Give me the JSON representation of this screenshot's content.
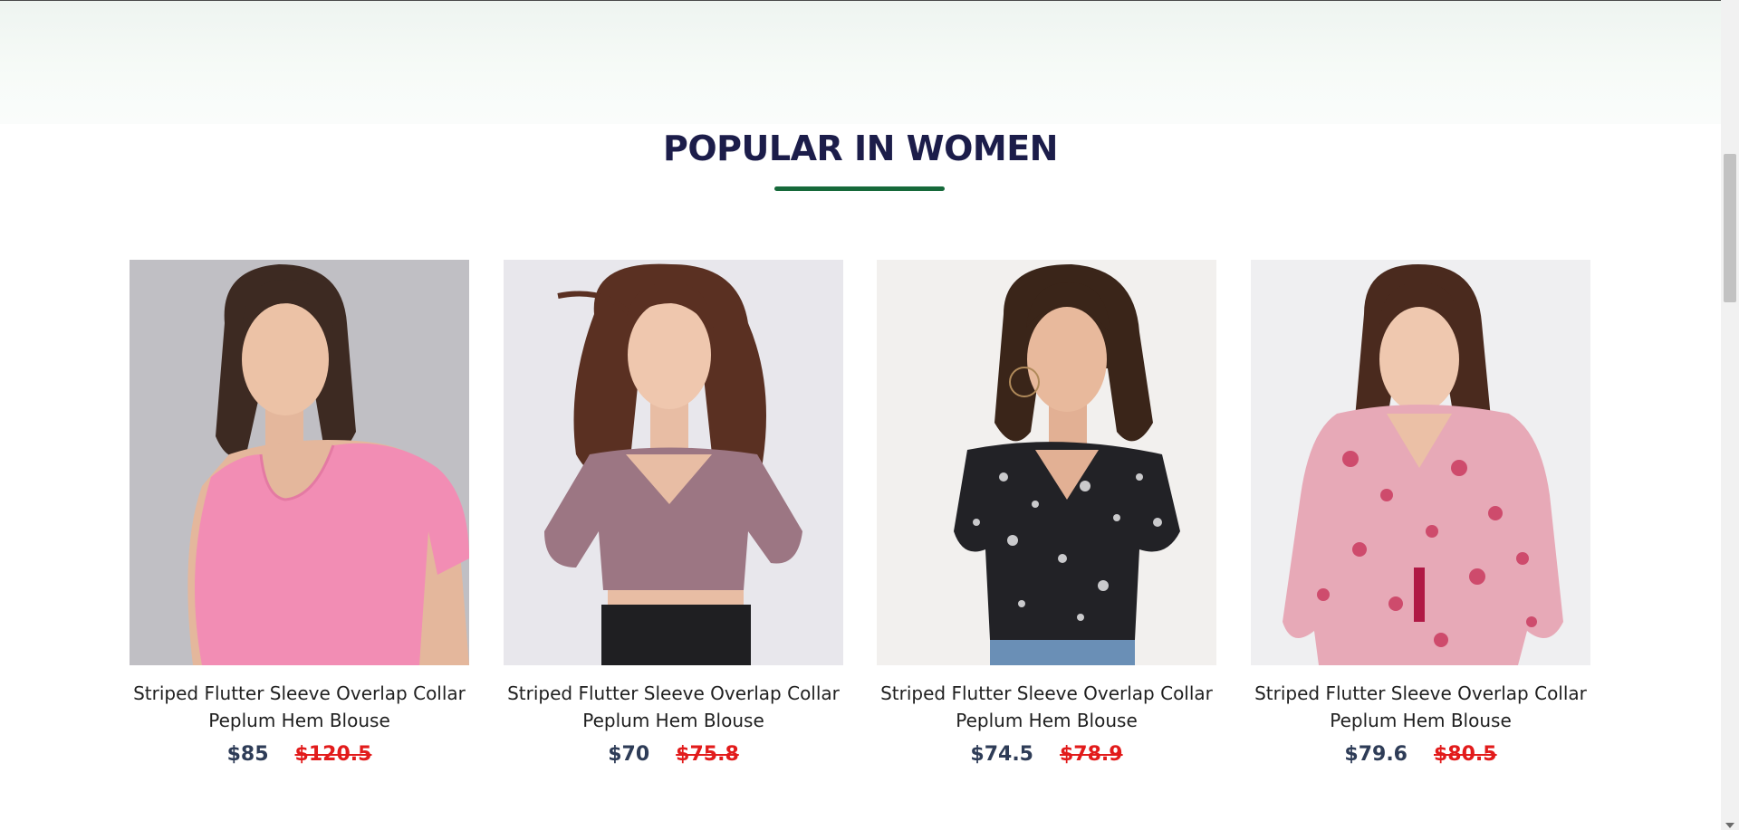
{
  "section": {
    "title": "POPULAR IN WOMEN",
    "accent_color": "#16693a"
  },
  "products": [
    {
      "name": "Striped Flutter Sleeve Overlap Collar Peplum Hem Blouse",
      "price": "$85",
      "old_price": "$120.5",
      "image": "model-pink-square-neck-top"
    },
    {
      "name": "Striped Flutter Sleeve Overlap Collar Peplum Hem Blouse",
      "price": "$70",
      "old_price": "$75.8",
      "image": "model-mauve-puff-sleeve-crop-top"
    },
    {
      "name": "Striped Flutter Sleeve Overlap Collar Peplum Hem Blouse",
      "price": "$74.5",
      "old_price": "$78.9",
      "image": "model-black-floral-top"
    },
    {
      "name": "Striped Flutter Sleeve Overlap Collar Peplum Hem Blouse",
      "price": "$79.6",
      "old_price": "$80.5",
      "image": "model-pink-floral-blouse"
    }
  ]
}
